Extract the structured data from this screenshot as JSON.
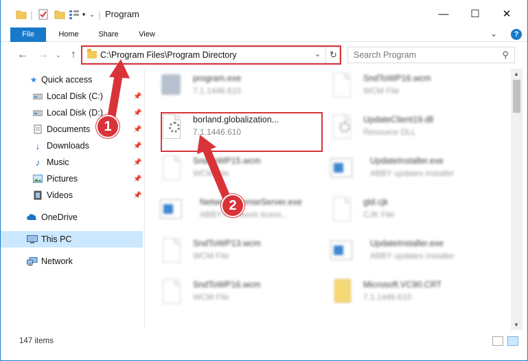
{
  "window": {
    "title": "Program",
    "minimize": "—",
    "maximize": "☐",
    "close": "✕"
  },
  "ribbon": {
    "tabs": [
      "File",
      "Home",
      "Share",
      "View"
    ],
    "help": "?"
  },
  "address": {
    "path": "C:\\Program Files\\Program Directory",
    "search_placeholder": "Search Program"
  },
  "sidebar": {
    "items": [
      {
        "label": "Quick access",
        "icon": "star-icon",
        "pinned": false
      },
      {
        "label": "Local Disk (C:)",
        "icon": "drive-icon",
        "pinned": true
      },
      {
        "label": "Local Disk (D:)",
        "icon": "drive-icon",
        "pinned": true
      },
      {
        "label": "Documents",
        "icon": "documents-icon",
        "pinned": true
      },
      {
        "label": "Downloads",
        "icon": "download-icon",
        "pinned": true
      },
      {
        "label": "Music",
        "icon": "music-icon",
        "pinned": true
      },
      {
        "label": "Pictures",
        "icon": "pictures-icon",
        "pinned": true
      },
      {
        "label": "Videos",
        "icon": "videos-icon",
        "pinned": true
      },
      {
        "label": "OneDrive",
        "icon": "cloud-icon",
        "pinned": false
      },
      {
        "label": "This PC",
        "icon": "pc-icon",
        "pinned": false,
        "selected": true
      },
      {
        "label": "Network",
        "icon": "network-icon",
        "pinned": false
      }
    ]
  },
  "files": [
    {
      "name": "program.exe",
      "sub": "7.1.1446.610",
      "icon": "installer-icon",
      "blurred": true
    },
    {
      "name": "SndToWP16.wcm",
      "sub": "WCM File",
      "icon": "document-icon",
      "blurred": true
    },
    {
      "name": "borland.globalization...",
      "sub": "7.1.1446.610",
      "icon": "settings-file-icon",
      "blurred": false
    },
    {
      "name": "UpdateClient19.dll",
      "sub": "Resource DLL",
      "icon": "settings-file-icon",
      "blurred": true
    },
    {
      "name": "SndToWP15.wcm",
      "sub": "WCM File",
      "icon": "document-icon",
      "blurred": true
    },
    {
      "name": "UpdateInstaller.exe",
      "sub": "ABBY updates installer",
      "icon": "application-icon",
      "blurred": true
    },
    {
      "name": "NetworkLicenseServer.exe",
      "sub": "ABBYY network licens...",
      "icon": "application-icon",
      "blurred": true
    },
    {
      "name": "gtd.cjk",
      "sub": "CJK File",
      "icon": "document-icon",
      "blurred": true
    },
    {
      "name": "SndToWP13.wcm",
      "sub": "WCM File",
      "icon": "document-icon",
      "blurred": true
    },
    {
      "name": "UpdateInstaller.exe",
      "sub": "ABBY updates installer",
      "icon": "application-icon",
      "blurred": true
    },
    {
      "name": "SndToWP16.wcm",
      "sub": "WCM File",
      "icon": "document-icon",
      "blurred": true
    },
    {
      "name": "Microsoft.VC90.CRT",
      "sub": "7.1.1446.610",
      "icon": "archive-icon",
      "blurred": true
    }
  ],
  "status": {
    "item_count": "147 items"
  },
  "annotations": {
    "step1": "1",
    "step2": "2"
  },
  "colors": {
    "accent": "#1979ca",
    "highlight": "#d9333a",
    "selection": "#cce8ff"
  }
}
